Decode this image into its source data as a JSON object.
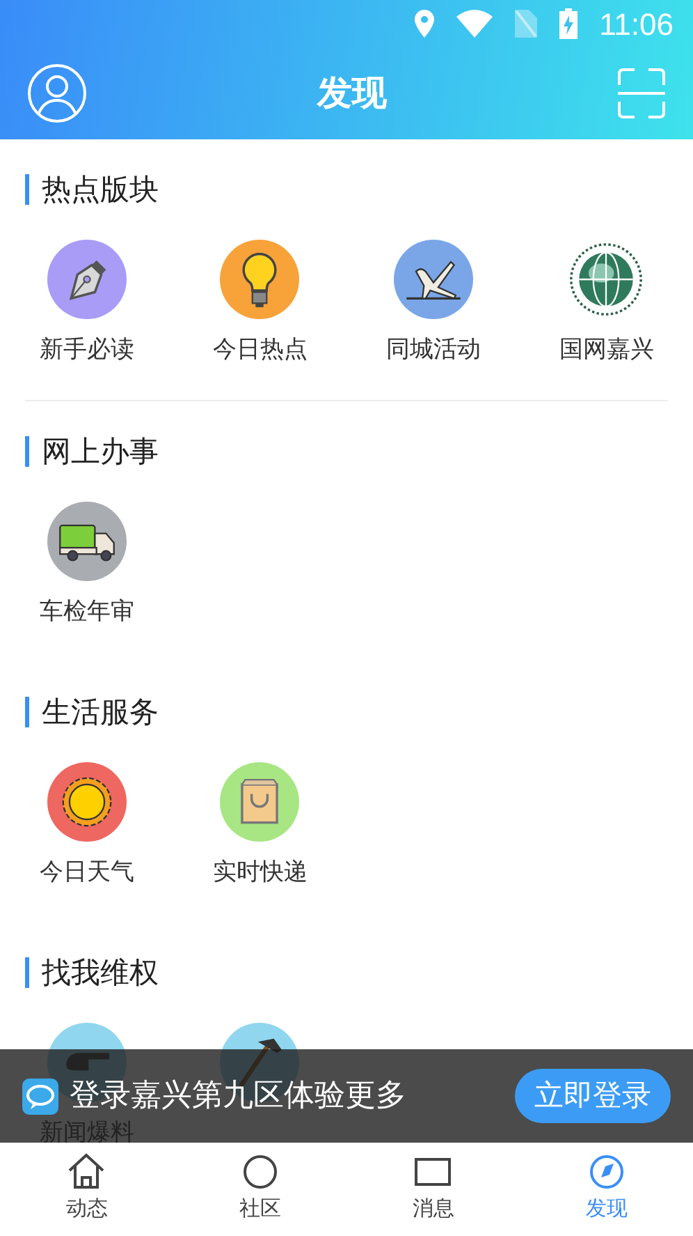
{
  "status_bar": {
    "time": "11:06"
  },
  "header": {
    "title": "发现"
  },
  "sections": [
    {
      "title": "热点版块",
      "items": [
        {
          "label": "新手必读",
          "kind": "pen"
        },
        {
          "label": "今日热点",
          "kind": "bulb"
        },
        {
          "label": "同城活动",
          "kind": "gymnast"
        },
        {
          "label": "国网嘉兴",
          "kind": "globe"
        }
      ]
    },
    {
      "title": "网上办事",
      "items": [
        {
          "label": "车检年审",
          "kind": "truck"
        }
      ]
    },
    {
      "title": "生活服务",
      "items": [
        {
          "label": "今日天气",
          "kind": "sun"
        },
        {
          "label": "实时快递",
          "kind": "bag"
        }
      ]
    },
    {
      "title": "找我维权",
      "items": [
        {
          "label": "新闻爆料",
          "kind": "hand"
        },
        {
          "kind": "hammer"
        }
      ]
    }
  ],
  "login_banner": {
    "text": "登录嘉兴第九区体验更多",
    "button": "立即登录"
  },
  "bottom_nav": [
    {
      "label": "动态",
      "selected": false
    },
    {
      "label": "社区",
      "selected": false
    },
    {
      "label": "消息",
      "selected": false
    },
    {
      "label": "发现",
      "selected": true
    }
  ]
}
